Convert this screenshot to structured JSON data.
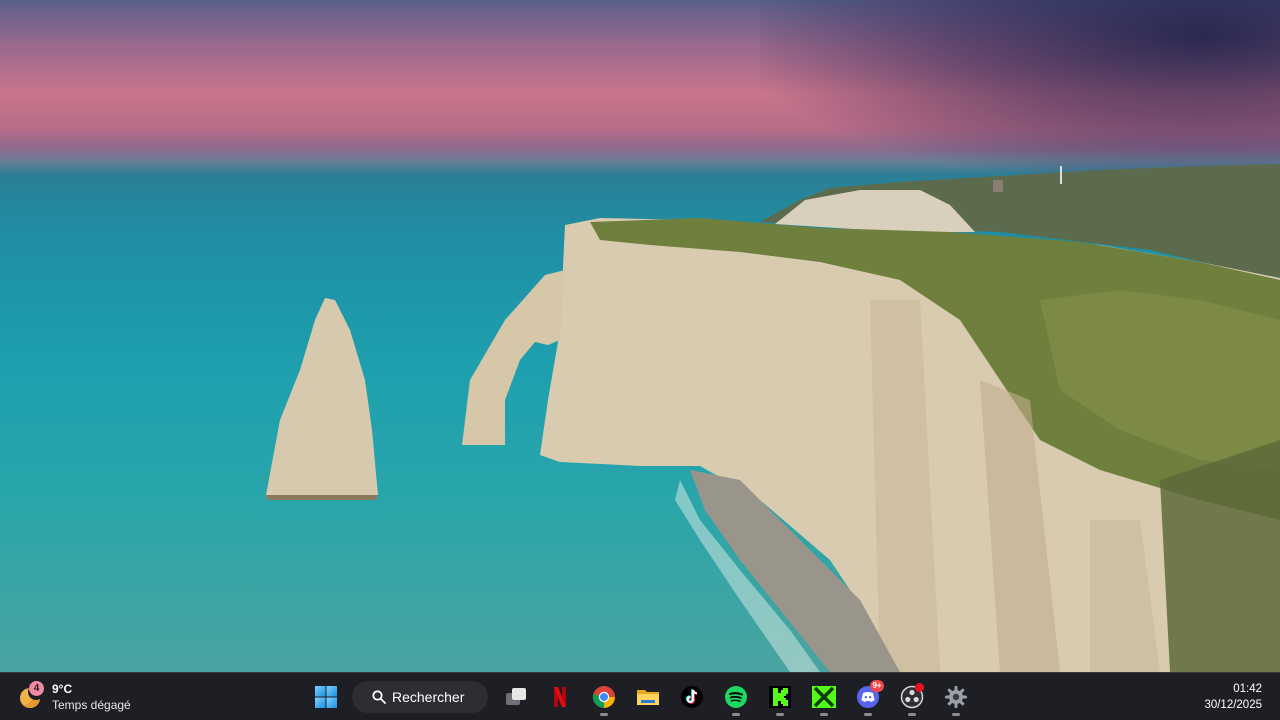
{
  "weather": {
    "badge": "4",
    "temperature": "9°C",
    "condition": "Temps dégagé",
    "icon": "moon-icon"
  },
  "taskbar": {
    "search_label": "Rechercher",
    "apps": [
      {
        "name": "start-button",
        "icon": "windows-logo-icon"
      },
      {
        "name": "task-view-button",
        "icon": "task-view-icon"
      },
      {
        "name": "netflix-button",
        "icon": "netflix-icon"
      },
      {
        "name": "chrome-button",
        "icon": "chrome-icon"
      },
      {
        "name": "file-explorer-button",
        "icon": "folder-icon"
      },
      {
        "name": "tiktok-button",
        "icon": "tiktok-icon"
      },
      {
        "name": "spotify-button",
        "icon": "spotify-icon"
      },
      {
        "name": "kick-button",
        "icon": "kick-icon"
      },
      {
        "name": "excel-like-button",
        "icon": "x-app-icon"
      },
      {
        "name": "discord-button",
        "icon": "discord-icon",
        "badge": "9+"
      },
      {
        "name": "obs-button",
        "icon": "obs-icon"
      },
      {
        "name": "settings-button",
        "icon": "gear-icon"
      }
    ],
    "discord_badge": "9+"
  },
  "clock": {
    "time": "01:42",
    "date": "30/12/2025"
  },
  "colors": {
    "taskbar_bg": "#1e1f24",
    "search_bg": "#2d2e34",
    "spotify": "#1ed760",
    "kick": "#53fc18",
    "discord": "#5865f2",
    "badge_red": "#e81123"
  }
}
